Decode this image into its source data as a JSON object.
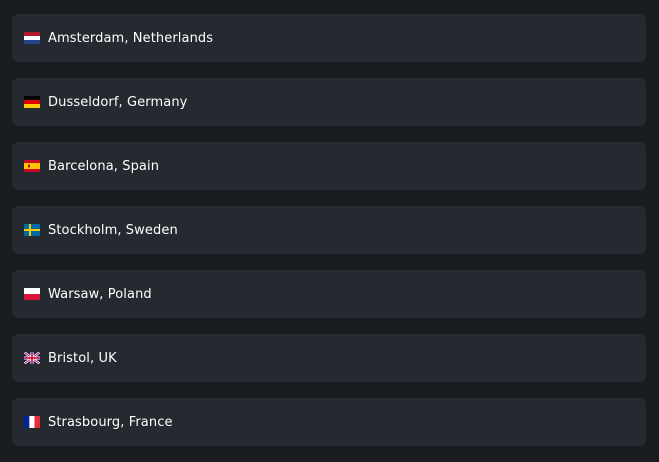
{
  "locations": [
    {
      "label": "Amsterdam, Netherlands",
      "flag_icon": "netherlands-flag-icon"
    },
    {
      "label": "Dusseldorf, Germany",
      "flag_icon": "germany-flag-icon"
    },
    {
      "label": "Barcelona, Spain",
      "flag_icon": "spain-flag-icon"
    },
    {
      "label": "Stockholm, Sweden",
      "flag_icon": "sweden-flag-icon"
    },
    {
      "label": "Warsaw, Poland",
      "flag_icon": "poland-flag-icon"
    },
    {
      "label": "Bristol, UK",
      "flag_icon": "uk-flag-icon"
    },
    {
      "label": "Strasbourg, France",
      "flag_icon": "france-flag-icon"
    }
  ],
  "colors": {
    "background": "#181b20",
    "item_background": "#252930",
    "text": "#ffffff"
  }
}
